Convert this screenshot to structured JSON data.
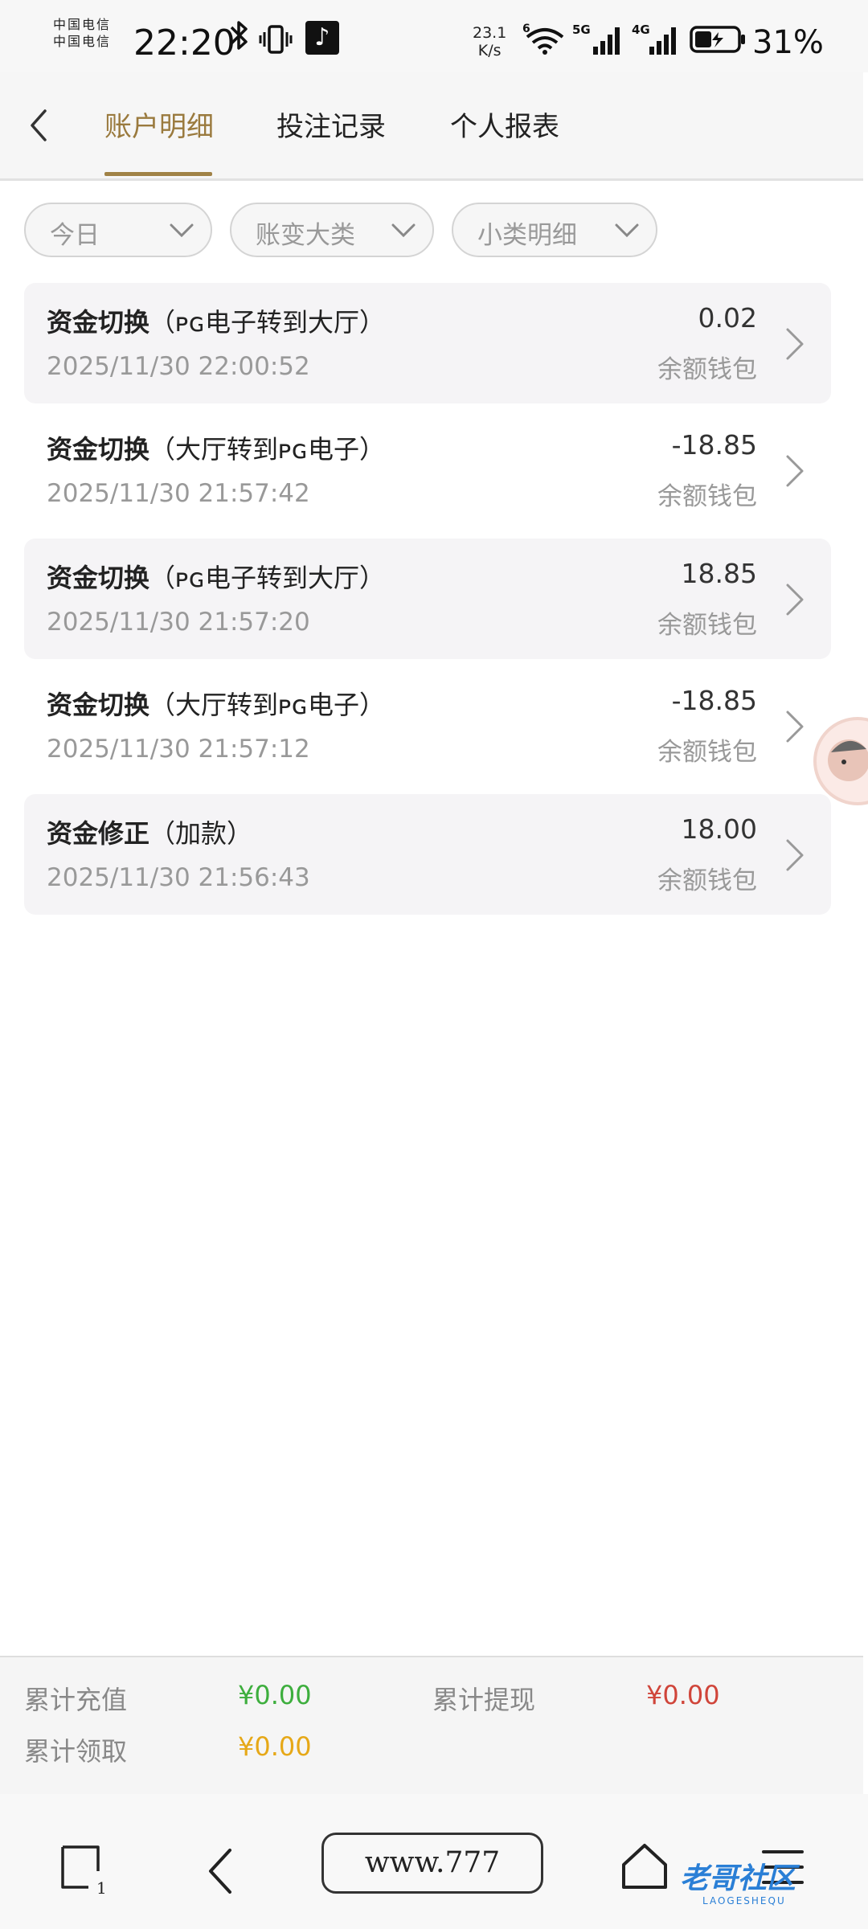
{
  "status_bar": {
    "carrier_line1": "中国电信",
    "carrier_line2": "中国电信",
    "time": "22:20",
    "net_speed_value": "23.1",
    "net_speed_unit": "K/s",
    "wifi_badge": "6",
    "sig1_label": "5G",
    "sig2_label": "4G",
    "battery_pct": "31%",
    "bluetooth_icon": "bluetooth-icon",
    "vibrate_icon": "vibrate-icon",
    "tiktok_icon": "tiktok-icon"
  },
  "header": {
    "back_icon": "chevron-left-icon",
    "tabs": [
      {
        "label": "账户明细",
        "active": true
      },
      {
        "label": "投注记录",
        "active": false
      },
      {
        "label": "个人报表",
        "active": false
      }
    ],
    "accent_color": "#9a7a3e"
  },
  "filters": [
    {
      "label": "今日"
    },
    {
      "label": "账变大类"
    },
    {
      "label": "小类明细"
    }
  ],
  "records": [
    {
      "title_bold": "资金切换",
      "title_detail": "（ᴘɢ电子转到大厅）",
      "time": "2025/11/30 22:00:52",
      "amount": "0.02",
      "wallet": "余额钱包"
    },
    {
      "title_bold": "资金切换",
      "title_detail": "（大厅转到ᴘɢ电子）",
      "time": "2025/11/30 21:57:42",
      "amount": "-18.85",
      "wallet": "余额钱包"
    },
    {
      "title_bold": "资金切换",
      "title_detail": "（ᴘɢ电子转到大厅）",
      "time": "2025/11/30 21:57:20",
      "amount": "18.85",
      "wallet": "余额钱包"
    },
    {
      "title_bold": "资金切换",
      "title_detail": "（大厅转到ᴘɢ电子）",
      "time": "2025/11/30 21:57:12",
      "amount": "-18.85",
      "wallet": "余额钱包"
    },
    {
      "title_bold": "资金修正",
      "title_detail": "（加款）",
      "time": "2025/11/30 21:56:43",
      "amount": "18.00",
      "wallet": "余额钱包"
    }
  ],
  "summary": {
    "recharge_label": "累计充值",
    "recharge_value": "¥0.00",
    "withdraw_label": "累计提现",
    "withdraw_value": "¥0.00",
    "claim_label": "累计领取",
    "claim_value": "¥0.00",
    "colors": {
      "recharge": "#3dae3d",
      "withdraw": "#d0453a",
      "claim": "#e6a817"
    }
  },
  "nav_bar": {
    "tab_count": "1",
    "url": "www.777",
    "watermark": "老哥社区",
    "watermark_sub": "LAOGESHEQU"
  }
}
